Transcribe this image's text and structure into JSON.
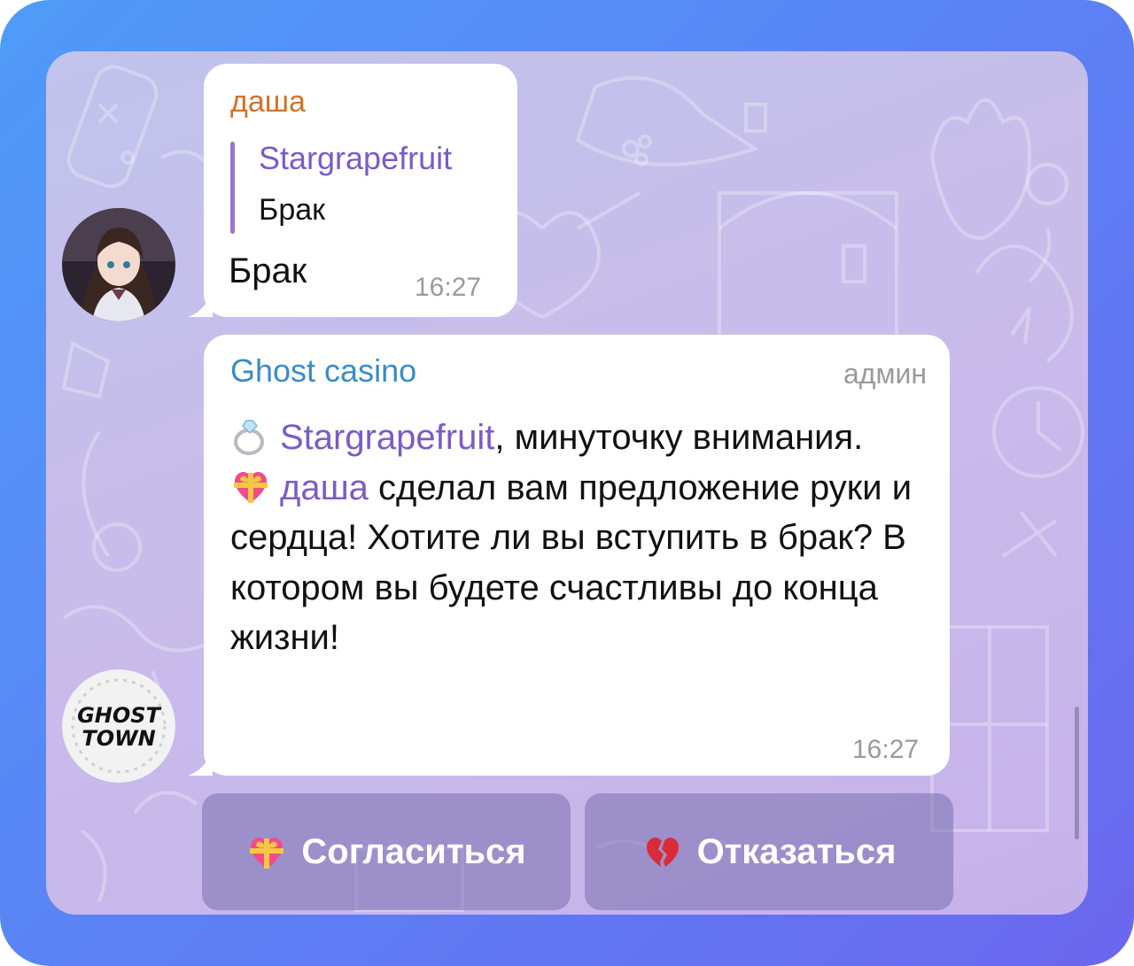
{
  "message1": {
    "sender": "даша",
    "reply": {
      "name": "Stargrapefruit",
      "text": "Брак"
    },
    "text": "Брак",
    "time": "16:27"
  },
  "message2": {
    "sender": "Ghost casino",
    "role": "админ",
    "mention1": "Stargrapefruit",
    "line1": ", минуточку внимания.",
    "mention2": "даша",
    "line2": " сделал вам предложение руки и сердца! Хотите ли вы вступить в брак? В котором вы будете счастливы до конца жизни!",
    "time": "16:27"
  },
  "avatars": {
    "user": "anime-girl-avatar",
    "bot": "ghost-town-logo",
    "bot_logo_text_line1": "GHOST",
    "bot_logo_text_line2": "TOWN"
  },
  "buttons": {
    "accept": {
      "label": "Согласиться",
      "icon": "heart-gift-icon"
    },
    "decline": {
      "label": "Отказаться",
      "icon": "broken-heart-icon"
    }
  },
  "colors": {
    "sender_orange": "#d2722a",
    "mention_purple": "#7a5bc7",
    "bot_name_blue": "#3a8cc6",
    "frame_gradient_start": "#4f9bf8",
    "frame_gradient_end": "#6b67ee"
  }
}
